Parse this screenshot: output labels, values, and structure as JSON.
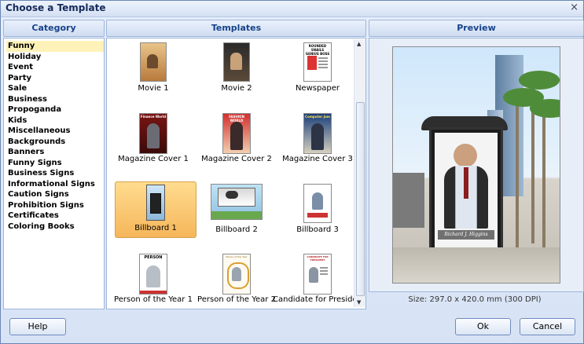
{
  "window": {
    "title": "Choose a Template",
    "close_glyph": "×"
  },
  "headers": {
    "category": "Category",
    "templates": "Templates",
    "preview": "Preview"
  },
  "categories": [
    "Funny",
    "Holiday",
    "Event",
    "Party",
    "Sale",
    "Business",
    "Propoganda",
    "Kids",
    "Miscellaneous",
    "Backgrounds",
    "Banners",
    "Funny Signs",
    "Business Signs",
    "Informational Signs",
    "Caution Signs",
    "Prohibition Signs",
    "Certificates",
    "Coloring Books"
  ],
  "selected_category": "Funny",
  "templates": [
    {
      "label": "Movie 1"
    },
    {
      "label": "Movie 2"
    },
    {
      "label": "Newspaper",
      "thumb_text": "ROUNDED SNAILS GENIUS BOSS"
    },
    {
      "label": "Magazine Cover 1",
      "thumb_text": "Finance World"
    },
    {
      "label": "Magazine Cover 2",
      "thumb_text": "FASHION WORLD"
    },
    {
      "label": "Magazine Cover 3",
      "thumb_text": "Computer Jam"
    },
    {
      "label": "Billboard 1"
    },
    {
      "label": "Billboard 2"
    },
    {
      "label": "Billboard 3"
    },
    {
      "label": "Person of the Year 1",
      "thumb_text": "PERSON"
    },
    {
      "label": "Person of the Year 2",
      "thumb_text": "Person of the Year"
    },
    {
      "label": "Candidate for President",
      "thumb_text": "CANDIDATE FOR PRESIDENT"
    }
  ],
  "selected_template": "Billboard 1",
  "preview": {
    "caption": "Richard J. Higgins",
    "size_text": "Size: 297.0 x 420.0 mm (300 DPI)"
  },
  "buttons": {
    "help": "Help",
    "ok": "Ok",
    "cancel": "Cancel"
  },
  "colors": {
    "accent": "#15428b",
    "selection": "#fff2b8",
    "selected_tile": "#f6b65a"
  }
}
